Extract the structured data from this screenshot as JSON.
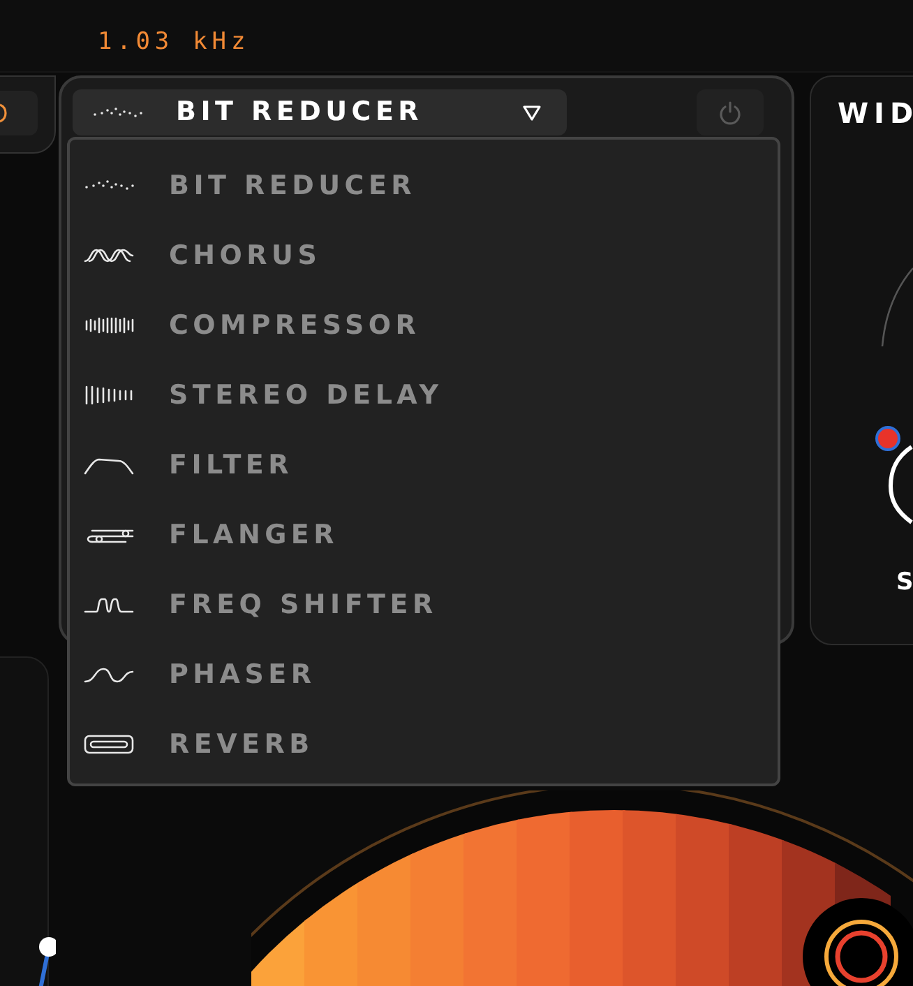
{
  "top_bar": {
    "frequency": "1.03 kHz"
  },
  "effect_panel": {
    "selector": {
      "value": "BIT REDUCER",
      "expanded": true
    },
    "power": {
      "on": false
    }
  },
  "effect_menu": {
    "items": [
      {
        "label": "BIT REDUCER",
        "kind": "bitcrush"
      },
      {
        "label": "CHORUS",
        "kind": "chorus"
      },
      {
        "label": "COMPRESSOR",
        "kind": "compressor"
      },
      {
        "label": "STEREO DELAY",
        "kind": "delay"
      },
      {
        "label": "FILTER",
        "kind": "filter"
      },
      {
        "label": "FLANGER",
        "kind": "flanger"
      },
      {
        "label": "FREQ SHIFTER",
        "kind": "shifter"
      },
      {
        "label": "PHASER",
        "kind": "phaser"
      },
      {
        "label": "REVERB",
        "kind": "reverb"
      }
    ]
  },
  "width_panel": {
    "title": "WID",
    "knob_label": "S"
  }
}
